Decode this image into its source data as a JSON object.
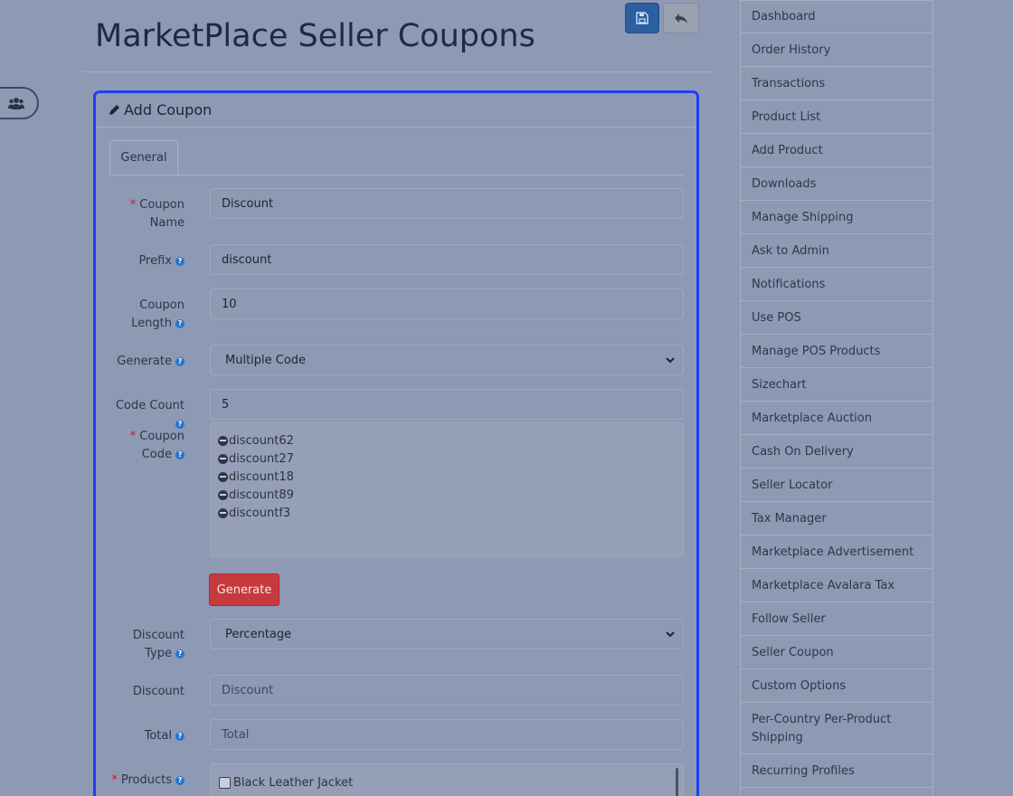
{
  "page": {
    "title": "MarketPlace Seller Coupons"
  },
  "panel": {
    "heading": "Add Coupon",
    "tab": "General"
  },
  "form": {
    "coupon_name": {
      "label1": "Coupon",
      "label2": "Name",
      "value": "Discount"
    },
    "prefix": {
      "label": "Prefix",
      "value": "discount"
    },
    "coupon_length": {
      "label1": "Coupon",
      "label2": "Length",
      "value": "10"
    },
    "generate": {
      "label": "Generate",
      "value": "Multiple Code"
    },
    "code_count": {
      "label": "Code Count",
      "value": "5"
    },
    "coupon_code": {
      "label1": "Coupon",
      "label2": "Code",
      "codes": [
        "discount62",
        "discount27",
        "discount18",
        "discount89",
        "discountf3"
      ]
    },
    "generate_button": "Generate",
    "discount_type": {
      "label1": "Discount",
      "label2": "Type",
      "value": "Percentage"
    },
    "discount": {
      "label": "Discount",
      "placeholder": "Discount"
    },
    "total": {
      "label": "Total",
      "placeholder": "Total"
    },
    "products": {
      "label": "Products",
      "items": [
        "Black Leather Jacket"
      ]
    }
  },
  "menu": {
    "items": [
      "Dashboard",
      "Order History",
      "Transactions",
      "Product List",
      "Add Product",
      "Downloads",
      "Manage Shipping",
      "Ask to Admin",
      "Notifications",
      "Use POS",
      "Manage POS Products",
      "Sizechart",
      "Marketplace Auction",
      "Cash On Delivery",
      "Seller Locator",
      "Tax Manager",
      "Marketplace Advertisement",
      "Marketplace Avalara Tax",
      "Follow Seller",
      "Seller Coupon",
      "Custom Options",
      "Per-Country Per-Product Shipping",
      "Recurring Profiles"
    ]
  },
  "icons": {
    "save": "save-icon",
    "back": "reply-icon",
    "users": "users-icon",
    "edit": "pencil-icon",
    "help": "question-circle-icon",
    "remove": "minus-circle-icon"
  },
  "colors": {
    "accent": "#1f3ff2",
    "primary": "#2a5fa0",
    "danger": "#c6393c",
    "required": "#c0202a",
    "help": "#2a75c9"
  }
}
